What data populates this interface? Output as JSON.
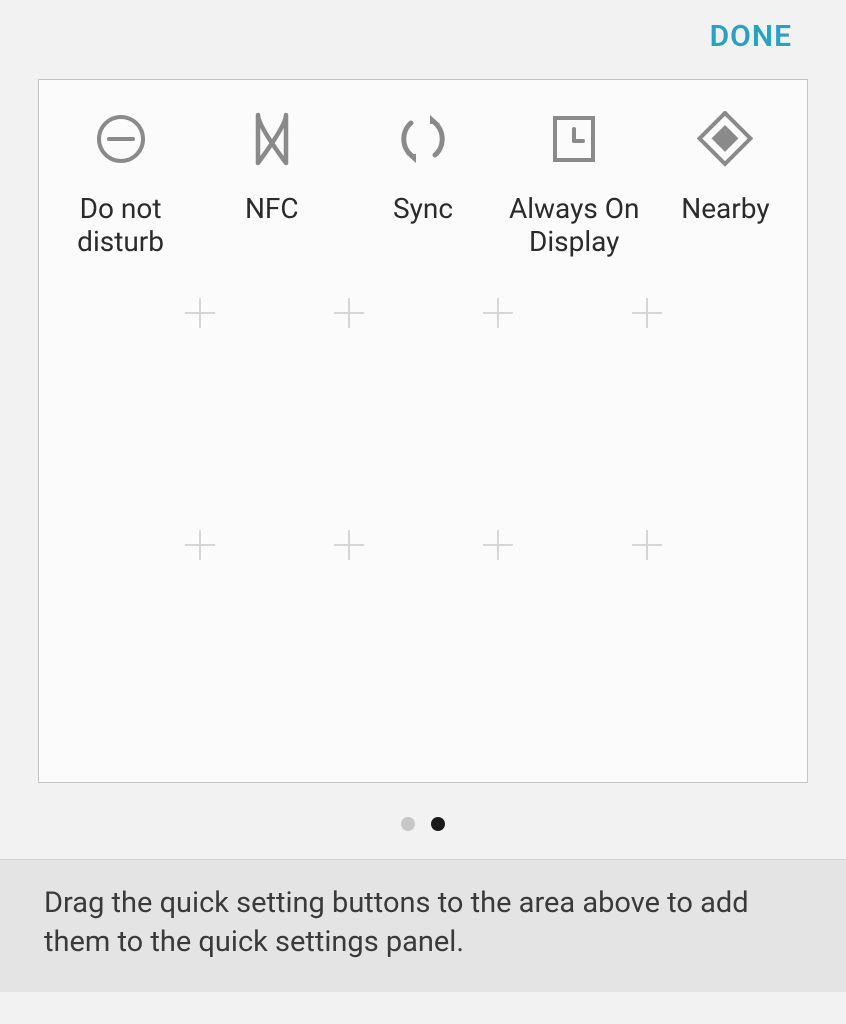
{
  "topbar": {
    "done_label": "DONE"
  },
  "tiles": [
    {
      "key": "dnd",
      "label": "Do not disturb"
    },
    {
      "key": "nfc",
      "label": "NFC"
    },
    {
      "key": "sync",
      "label": "Sync"
    },
    {
      "key": "aod",
      "label": "Always On Display"
    },
    {
      "key": "nearby",
      "label": "Nearby"
    }
  ],
  "pager": {
    "count": 2,
    "active": 1
  },
  "hint": "Drag the quick setting buttons to the area above to add them to the quick settings panel."
}
